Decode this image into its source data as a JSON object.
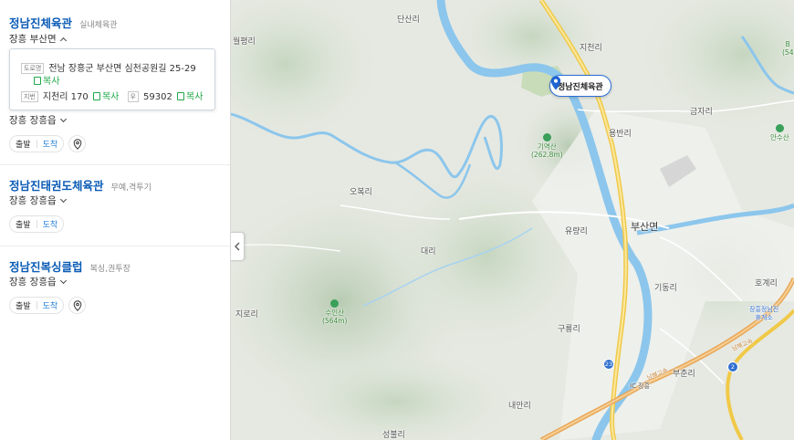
{
  "results": [
    {
      "name": "정남진체육관",
      "category": "실내체육관",
      "region": "장흥 부산면",
      "region_chevron": "up",
      "address_popup": {
        "road_tag": "도로명",
        "road_address_line1": "전남 장흥군 부산면 심천공원길 25-29",
        "copy_label": "복사",
        "jibun_tag": "지번",
        "jibun_address": "지천리 170",
        "zip_tag": "우",
        "zip": "59302"
      }
    },
    {
      "region": "장흥 장흥읍",
      "region_chevron": "down"
    },
    {
      "name": "정남진태권도체육관",
      "category": "무예,격투기",
      "region": "장흥 장흥읍",
      "region_chevron": "down"
    },
    {
      "name": "정남진복싱클럽",
      "category": "복싱,권투장",
      "region": "장흥 장흥읍",
      "region_chevron": "down"
    }
  ],
  "buttons": {
    "depart": "출발",
    "arrive": "도착"
  },
  "icons": {
    "pin": "map-pin-icon",
    "copy": "copy-icon",
    "collapse": "chevron-left-icon",
    "marker": "map-marker-icon"
  },
  "colors": {
    "link_blue": "#0a5bb5",
    "copy_green": "#21a84a",
    "marker_blue": "#2b6fd6",
    "river": "#8cc6ec",
    "road_yellow": "#f3d36b"
  },
  "map": {
    "marker_label": "정남진체육관",
    "labels": {
      "danshan": "단산리",
      "jicheon": "지천리",
      "wolpyeong": "월평리",
      "obokri": "오복리",
      "daeri": "대리",
      "yuryang": "유량리",
      "busanmyeon": "부산면",
      "yongban": "용반리",
      "geumjari": "금자리",
      "gidong": "기동리",
      "hogye": "호계리",
      "jiro": "지로리",
      "guryong": "구룡리",
      "buchun": "부춘리",
      "naeanri": "내안리",
      "seongbul": "성불리",
      "ic": "IC 장흥",
      "rest_area": "장흥정남진\n휴게소",
      "road_label_1": "남해고속",
      "road_label_2": "남해고속"
    },
    "peaks": [
      {
        "name": "기역산",
        "height": "(262.8m)"
      },
      {
        "name": "수인산",
        "height": "(564m)"
      },
      {
        "name": "안수산",
        "height": ""
      },
      {
        "name": "B",
        "height": "(54"
      }
    ],
    "route_shields": [
      "23",
      "2"
    ]
  }
}
